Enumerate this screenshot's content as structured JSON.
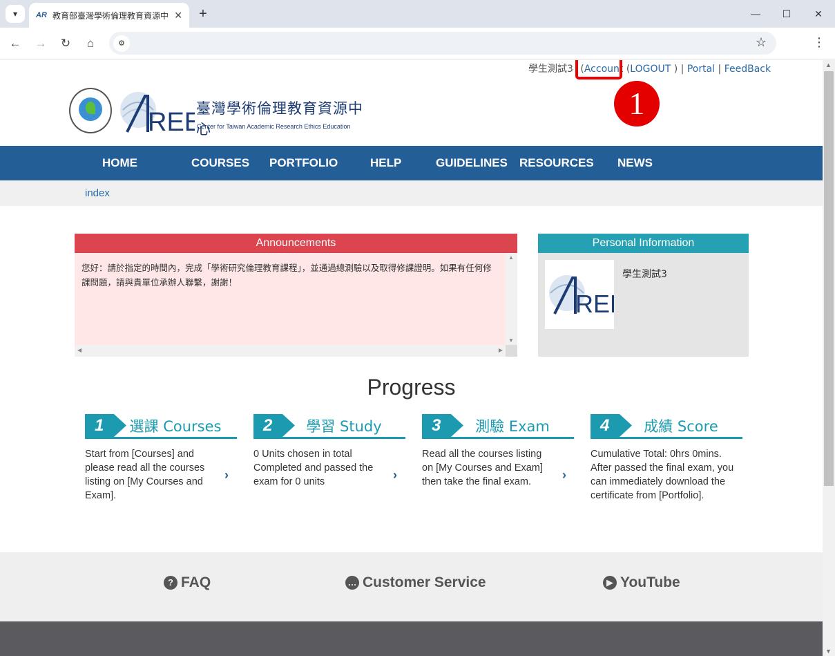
{
  "browser": {
    "tab_title": "教育部臺灣學術倫理教育資源中心",
    "favicon": "AR"
  },
  "userbar": {
    "username": "學生測試3",
    "account_link": "Account",
    "logout_link": "LOGOUT",
    "portal_link": "Portal",
    "feedback_link": "FeedBack"
  },
  "annotation": {
    "step_marker": "1"
  },
  "logo": {
    "seal_text": "MINISTRY OF EDUCATION",
    "brand": "AREE",
    "title_zh": "臺灣學術倫理教育資源中心",
    "title_en": "Center for Taiwan Academic Research Ethics Education"
  },
  "nav": {
    "items": [
      "HOME",
      "COURSES",
      "PORTFOLIO",
      "HELP",
      "GUIDELINES",
      "RESOURCES",
      "NEWS"
    ]
  },
  "breadcrumb": "index",
  "announcements": {
    "title": "Announcements",
    "body": "您好：請於指定的時間內，完成「學術研究倫理教育課程」，並通過總測驗以及取得修課證明。如果有任何修課問題，請與貴單位承辦人聯繫，謝謝！"
  },
  "personal_info": {
    "title": "Personal Information",
    "name": "學生測試3"
  },
  "progress": {
    "title": "Progress",
    "steps": [
      {
        "num": "1",
        "label": "選課 Courses",
        "text": "Start from [Courses] and please read all the courses listing on [My Courses and Exam]."
      },
      {
        "num": "2",
        "label": "學習 Study",
        "text": "0 Units chosen in total Completed and passed the exam for 0 units"
      },
      {
        "num": "3",
        "label": "測驗 Exam",
        "text": "Read all the courses listing on [My Courses and Exam] then take the final exam."
      },
      {
        "num": "4",
        "label": "成績 Score",
        "text": "Cumulative Total: 0hrs 0mins. After passed the final exam, you can immediately download the certificate from [Portfolio]."
      }
    ]
  },
  "footer": {
    "faq": "FAQ",
    "customer_service": "Customer Service",
    "youtube": "YouTube"
  },
  "colors": {
    "nav_blue": "#245e97",
    "announce_red": "#dc4450",
    "teal": "#1c9bb0",
    "highlight_red": "#e00000"
  }
}
